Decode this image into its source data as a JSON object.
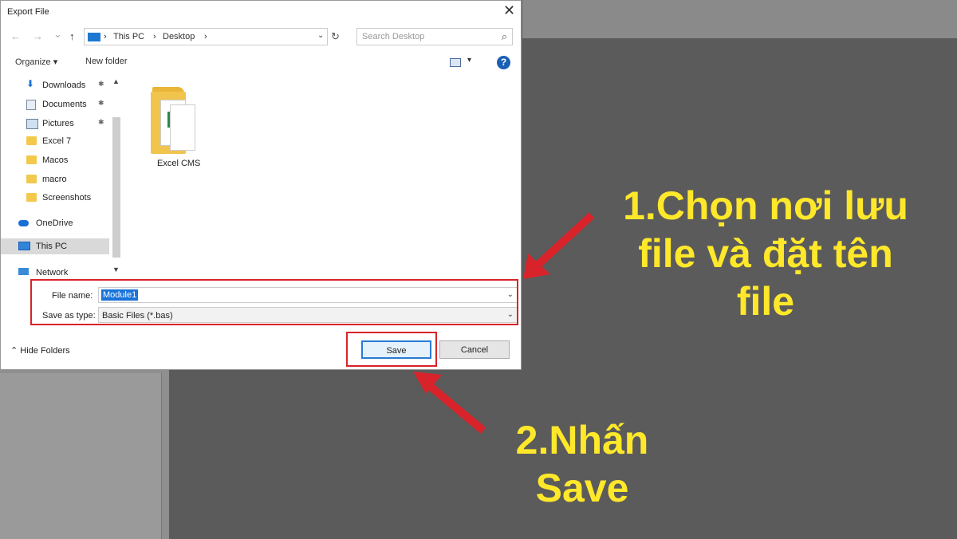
{
  "dialog": {
    "title": "Export File",
    "close_glyph": "✕",
    "nav": {
      "back": "←",
      "forward": "→",
      "recent": "⌄",
      "up": "↑"
    },
    "breadcrumb": [
      "This PC",
      "Desktop"
    ],
    "breadcrumb_sep": "›",
    "addr_dropdown": "⌄",
    "refresh": "↻",
    "search_placeholder": "Search Desktop",
    "search_icon": "⌕",
    "toolbar": {
      "organize": "Organize ▾",
      "new_folder": "New folder",
      "view_dd": "▾",
      "help": "?"
    },
    "sidebar": [
      {
        "label": "Downloads",
        "icon": "download-icon",
        "pinned": true
      },
      {
        "label": "Documents",
        "icon": "documents-icon",
        "pinned": true
      },
      {
        "label": "Pictures",
        "icon": "pictures-icon",
        "pinned": true
      },
      {
        "label": "Excel 7",
        "icon": "folder-icon",
        "pinned": false
      },
      {
        "label": "Macos",
        "icon": "folder-icon",
        "pinned": false
      },
      {
        "label": "macro",
        "icon": "folder-icon",
        "pinned": false
      },
      {
        "label": "Screenshots",
        "icon": "folder-icon",
        "pinned": false
      },
      {
        "label": "OneDrive",
        "icon": "cloud-icon",
        "pinned": false
      },
      {
        "label": "This PC",
        "icon": "computer-icon",
        "pinned": false,
        "selected": true
      },
      {
        "label": "Network",
        "icon": "network-icon",
        "pinned": false
      }
    ],
    "pin_glyph": "📌",
    "files": [
      {
        "label": "Excel CMS",
        "icon": "folder-icon"
      }
    ],
    "file_name_label": "File name:",
    "file_name_value": "Module1",
    "save_type_label": "Save as type:",
    "save_type_value": "Basic Files (*.bas)",
    "hide_folders": "⌃ Hide Folders",
    "save": "Save",
    "cancel": "Cancel"
  },
  "annotations": {
    "step1": "1.Chọn nơi lưu file và đặt tên file",
    "step2": "2.Nhấn Save"
  },
  "colors": {
    "highlight_red": "#d8232a",
    "annotation_yellow": "#ffe82a",
    "selection_blue": "#1a73d9"
  }
}
